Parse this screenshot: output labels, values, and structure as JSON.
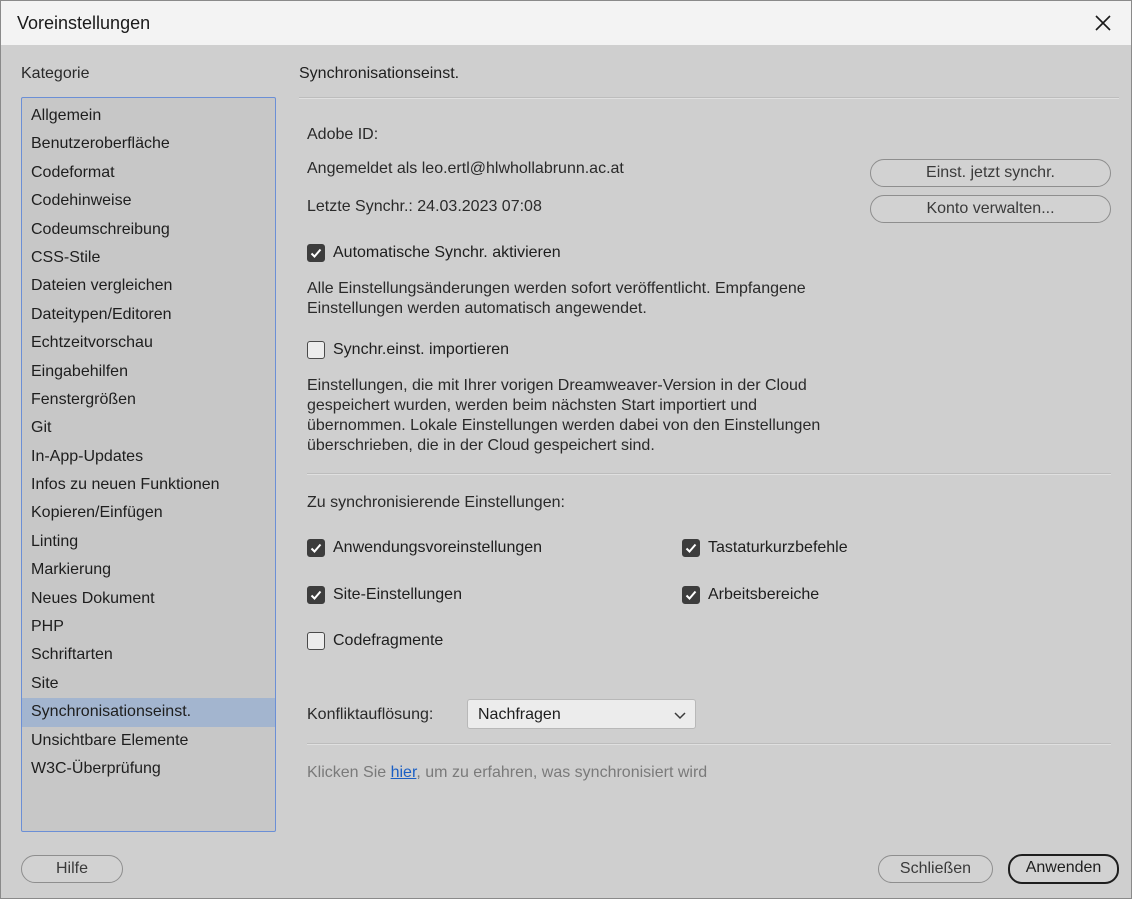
{
  "window": {
    "title": "Voreinstellungen"
  },
  "sidebar": {
    "label": "Kategorie",
    "items": [
      {
        "label": "Allgemein"
      },
      {
        "label": "Benutzeroberfläche"
      },
      {
        "label": "Codeformat"
      },
      {
        "label": "Codehinweise"
      },
      {
        "label": "Codeumschreibung"
      },
      {
        "label": "CSS-Stile"
      },
      {
        "label": "Dateien vergleichen"
      },
      {
        "label": "Dateitypen/Editoren"
      },
      {
        "label": "Echtzeitvorschau"
      },
      {
        "label": "Eingabehilfen"
      },
      {
        "label": "Fenstergrößen"
      },
      {
        "label": "Git"
      },
      {
        "label": "In-App-Updates"
      },
      {
        "label": "Infos zu neuen Funktionen"
      },
      {
        "label": "Kopieren/Einfügen"
      },
      {
        "label": "Linting"
      },
      {
        "label": "Markierung"
      },
      {
        "label": "Neues Dokument"
      },
      {
        "label": "PHP"
      },
      {
        "label": "Schriftarten"
      },
      {
        "label": "Site"
      },
      {
        "label": "Synchronisationseinst."
      },
      {
        "label": "Unsichtbare Elemente"
      },
      {
        "label": "W3C-Überprüfung"
      }
    ],
    "selected": "Synchronisationseinst."
  },
  "main": {
    "section_title": "Synchronisationseinst.",
    "adobe_id_label": "Adobe ID:",
    "signed_in": "Angemeldet als leo.ertl@hlwhollabrunn.ac.at",
    "last_sync": "Letzte Synchr.: 24.03.2023 07:08",
    "sync_now_button": "Einst. jetzt synchr.",
    "manage_account_button": "Konto verwalten...",
    "auto_sync": {
      "label": "Automatische Synchr. aktivieren",
      "checked": true
    },
    "auto_sync_desc_1": "Alle Einstellungsänderungen werden sofort veröffentlicht. Empfangene",
    "auto_sync_desc_2": "Einstellungen werden automatisch angewendet.",
    "import": {
      "label": "Synchr.einst. importieren",
      "checked": false
    },
    "import_desc_1": "Einstellungen, die mit Ihrer vorigen Dreamweaver-Version in der Cloud",
    "import_desc_2": "gespeichert wurden, werden beim nächsten Start importiert und",
    "import_desc_3": "übernommen. Lokale Einstellungen werden dabei von den Einstellungen",
    "import_desc_4": "überschrieben, die in der Cloud gespeichert sind.",
    "settings_heading": "Zu synchronisierende Einstellungen:",
    "settings": {
      "app_prefs": {
        "label": "Anwendungsvoreinstellungen",
        "checked": true
      },
      "shortcuts": {
        "label": "Tastaturkurzbefehle",
        "checked": true
      },
      "site_settings": {
        "label": "Site-Einstellungen",
        "checked": true
      },
      "workspaces": {
        "label": "Arbeitsbereiche",
        "checked": true
      },
      "code_fragments": {
        "label": "Codefragmente",
        "checked": false
      }
    },
    "conflict_label": "Konfliktauflösung:",
    "conflict_value": "Nachfragen",
    "footer_prefix": "Klicken Sie ",
    "footer_link": "hier",
    "footer_suffix": ", um zu erfahren, was synchronisiert wird"
  },
  "buttons": {
    "help": "Hilfe",
    "close": "Schließen",
    "apply": "Anwenden"
  }
}
